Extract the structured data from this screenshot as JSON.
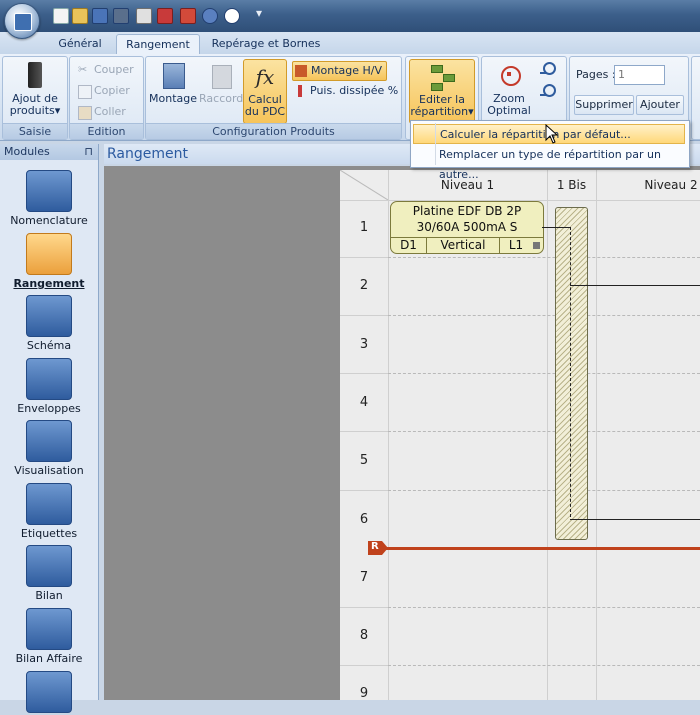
{
  "tabs": {
    "general": "Général",
    "rangement": "Rangement",
    "reperage": "Repérage et Bornes"
  },
  "ribbon": {
    "saisie": {
      "title": "Saisie",
      "ajout": "Ajout de",
      "ajout2": "produits"
    },
    "edition": {
      "title": "Edition",
      "couper": "Couper",
      "copier": "Copier",
      "coller": "Coller"
    },
    "config": {
      "title": "Configuration Produits",
      "montage": "Montage",
      "raccord": "Raccord",
      "calcul1": "Calcul",
      "calcul2": "du PDC",
      "montage_hv": "Montage H/V",
      "puis": "Puis. dissipée %"
    },
    "repartition": {
      "editer1": "Editer la",
      "editer2": "répartition"
    },
    "zoom": {
      "label1": "Zoom",
      "label2": "Optimal"
    },
    "pages": {
      "label": "Pages :",
      "value": "1",
      "supprimer": "Supprimer",
      "ajouter": "Ajouter"
    }
  },
  "dropdown": {
    "item1": "Calculer la répartition par défaut...",
    "item2": "Remplacer un type de répartition par un autre..."
  },
  "modules": {
    "header": "Modules",
    "items": [
      "Nomenclature",
      "Rangement",
      "Schéma",
      "Enveloppes",
      "Visualisation",
      "Etiquettes",
      "Bilan",
      "Bilan Affaire"
    ]
  },
  "doc": {
    "title": "Rangement"
  },
  "grid": {
    "columns": [
      "Niveau 1",
      "1 Bis",
      "Niveau 2"
    ],
    "rows": [
      "1",
      "2",
      "3",
      "4",
      "5",
      "6",
      "7",
      "8",
      "9"
    ],
    "marker": "R",
    "product": {
      "line1": "Platine EDF DB 2P",
      "line2": "30/60A 500mA S",
      "cells": [
        "D1",
        "Vertical",
        "L1"
      ]
    }
  },
  "colors": {
    "accent": "#f6c45a",
    "rail": "#c0421c",
    "title_blue": "#2b5aa0"
  }
}
